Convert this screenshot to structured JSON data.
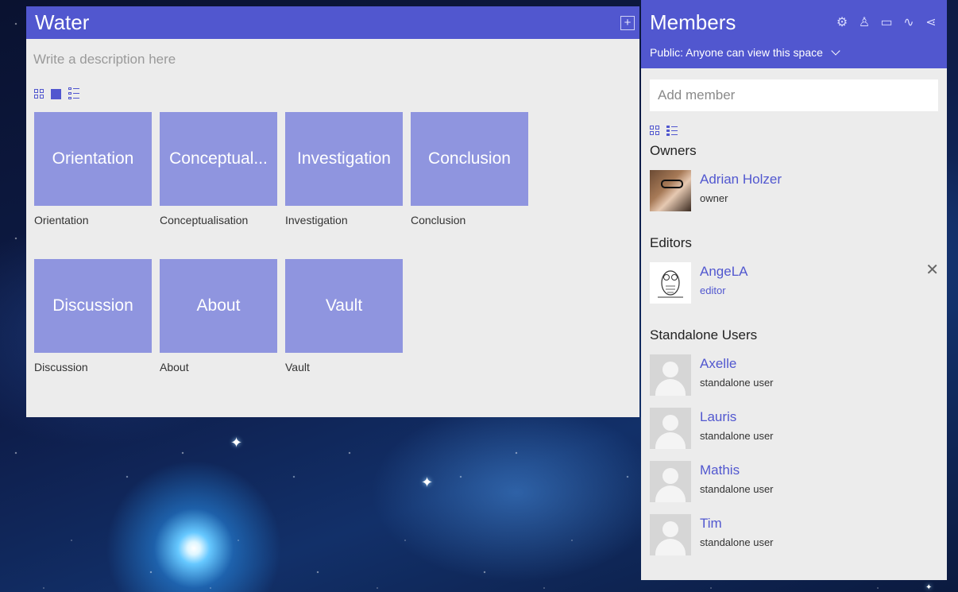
{
  "space": {
    "title": "Water",
    "add_icon": "plus-square-icon",
    "description_placeholder": "Write a description here",
    "view_modes": [
      "grid-icon",
      "square-icon",
      "list-icon"
    ],
    "tiles": [
      {
        "label": "Orientation",
        "caption": "Orientation"
      },
      {
        "label": "Conceptual...",
        "caption": "Conceptualisation"
      },
      {
        "label": "Investigation",
        "caption": "Investigation"
      },
      {
        "label": "Conclusion",
        "caption": "Conclusion"
      },
      {
        "label": "Discussion",
        "caption": "Discussion"
      },
      {
        "label": "About",
        "caption": "About"
      },
      {
        "label": "Vault",
        "caption": "Vault"
      }
    ]
  },
  "members": {
    "title": "Members",
    "header_icons": [
      "gear-icon",
      "user-icon",
      "comment-icon",
      "activity-icon",
      "share-icon"
    ],
    "visibility": "Public: Anyone can view this space",
    "add_placeholder": "Add member",
    "owners_title": "Owners",
    "owners": [
      {
        "name": "Adrian Holzer",
        "role": "owner"
      }
    ],
    "editors_title": "Editors",
    "editors": [
      {
        "name": "AngeLA",
        "role": "editor"
      }
    ],
    "standalone_title": "Standalone Users",
    "standalone": [
      {
        "name": "Axelle",
        "role": "standalone user"
      },
      {
        "name": "Lauris",
        "role": "standalone user"
      },
      {
        "name": "Mathis",
        "role": "standalone user"
      },
      {
        "name": "Tim",
        "role": "standalone user"
      }
    ]
  },
  "colors": {
    "accent": "#5157cf",
    "tile": "#8f95df",
    "panel": "#ececec"
  }
}
